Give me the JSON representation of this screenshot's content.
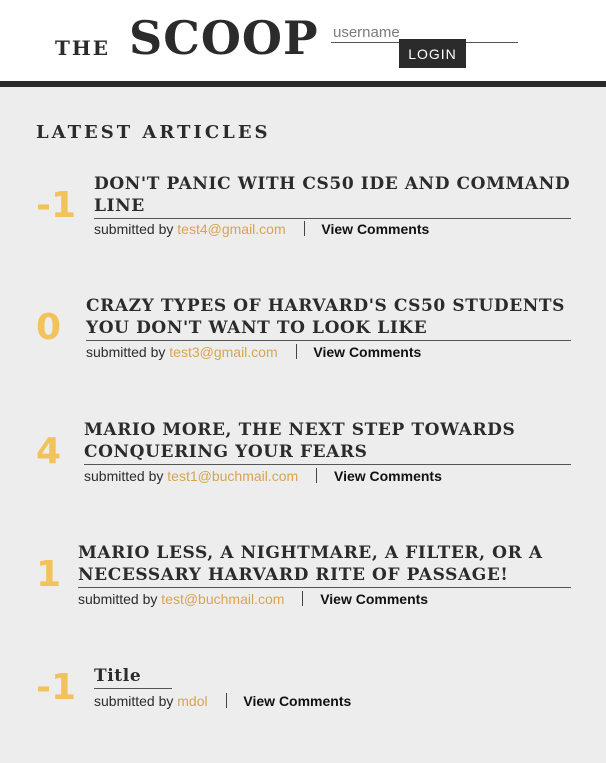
{
  "header": {
    "logo_the": "THE",
    "logo_scoop": "SCOOP",
    "username_placeholder": "username",
    "login_label": "LOGIN"
  },
  "section_title": "LATEST ARTICLES",
  "submitted_by_label": "submitted by",
  "articles": [
    {
      "score": "-1",
      "title": "DON'T PANIC WITH CS50 IDE AND COMMAND LINE",
      "author": "test4@gmail.com",
      "view_label": "View Comments"
    },
    {
      "score": "0",
      "title": "CRAZY TYPES OF HARVARD'S CS50 STUDENTS YOU DON'T WANT TO LOOK LIKE",
      "author": "test3@gmail.com",
      "view_label": "View Comments"
    },
    {
      "score": "4",
      "title": "MARIO MORE, THE NEXT STEP TOWARDS CONQUERING YOUR FEARS",
      "author": "test1@buchmail.com",
      "view_label": "View Comments"
    },
    {
      "score": "1",
      "title": "MARIO LESS, A NIGHTMARE, A FILTER, OR A NECESSARY HARVARD RITE OF PASSAGE!",
      "author": "test@buchmail.com",
      "view_label": "View Comments"
    },
    {
      "score": "-1",
      "title": "Title",
      "author": "mdol",
      "view_label": "View Comments"
    }
  ],
  "colors": {
    "score": "#f2c35a",
    "author_link": "#d7a450",
    "dark": "#2b2b2b",
    "background": "#ededed"
  }
}
